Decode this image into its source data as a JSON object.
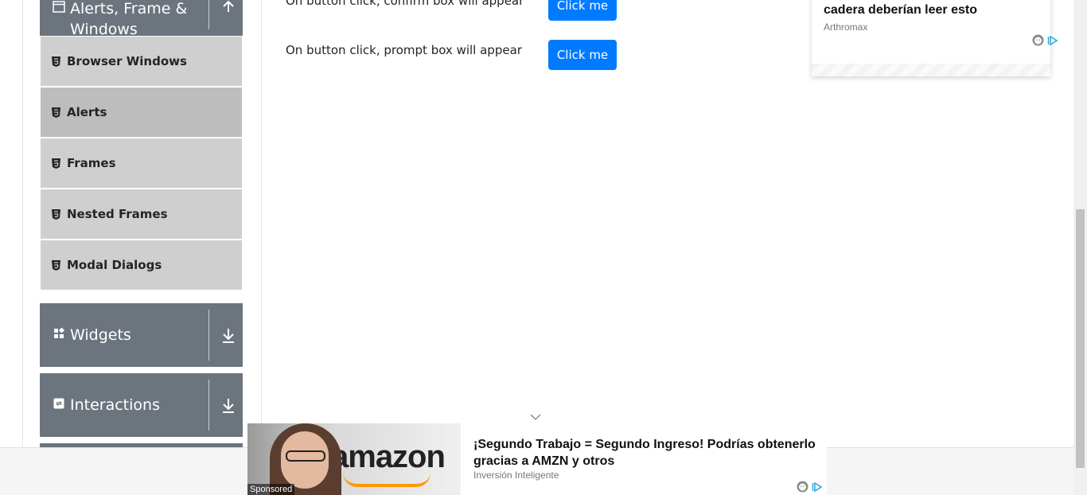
{
  "sidebar": {
    "alerts_group": {
      "title_line1": "Alerts, Frame &",
      "title_line2": "Windows"
    },
    "items": [
      {
        "label": "Browser Windows"
      },
      {
        "label": "Alerts"
      },
      {
        "label": "Frames"
      },
      {
        "label": "Nested Frames"
      },
      {
        "label": "Modal Dialogs"
      }
    ],
    "widgets_group": {
      "title": "Widgets"
    },
    "interactions_group": {
      "title": "Interactions"
    }
  },
  "content": {
    "rows": [
      {
        "text": "On button click, confirm box will appear",
        "button": "Click me"
      },
      {
        "text": "On button click, prompt box will appear",
        "button": "Click me"
      }
    ]
  },
  "ad_top": {
    "title": "cadera deberían leer esto",
    "source": "Arthromax"
  },
  "ad_bottom": {
    "title": "¡Segundo Trabajo = Segundo Ingreso! Podrías obtenerlo gracias a AMZN y otros",
    "source": "Inversión Inteligente",
    "sponsored": "Sponsored",
    "image_word": "amazon"
  },
  "colors": {
    "primary_button": "#007bff",
    "group_header": "#6c757d",
    "menu_item": "#cfcfcf"
  }
}
